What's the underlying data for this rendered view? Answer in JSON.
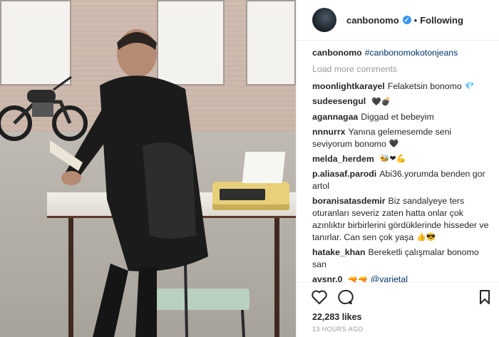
{
  "post": {
    "author": "canbonomo",
    "verified_icon": "verified-badge-icon",
    "separator": "•",
    "follow_state": "Following"
  },
  "caption": {
    "user": "canbonomo",
    "hashtag": "#canbonomokotonjeans"
  },
  "load_more_label": "Load more comments",
  "comments": [
    {
      "user": "moonlightkarayel",
      "text": "Felaketsin bonomo",
      "emoji": "💎"
    },
    {
      "user": "sudeesengul",
      "text": "",
      "emoji": "🖤💣"
    },
    {
      "user": "agannagaa",
      "text": "Diggad et bebeyim",
      "emoji": ""
    },
    {
      "user": "nnnurrx",
      "text": "Yanına gelemesemde seni seviyorum bonomo",
      "emoji": "🖤"
    },
    {
      "user": "melda_herdem",
      "text": "",
      "emoji": "🐝❤💪"
    },
    {
      "user": "p.aliasaf.parodi",
      "text": "Abi36.yorumda benden gor artol",
      "emoji": ""
    },
    {
      "user": "boranisatasdemir",
      "text": "Biz sandalyeye ters oturanları severiz zaten hatta onlar çok azınlıktır birbirlerini gördüklerinde hisseder ve tanırlar. Can sen çok yaşa",
      "emoji": "👍😎"
    },
    {
      "user": "hatake_khan",
      "text": "Bereketli çalışmalar bonomo san",
      "emoji": ""
    },
    {
      "user": "avsnr.0",
      "text": "",
      "emoji": "🔫🔫",
      "mention": "@varietal"
    }
  ],
  "actions": {
    "like_icon": "heart-icon",
    "comment_icon": "comment-bubble-icon",
    "save_icon": "bookmark-icon"
  },
  "likes": "22,283 likes",
  "timestamp": "13 HOURS AGO"
}
